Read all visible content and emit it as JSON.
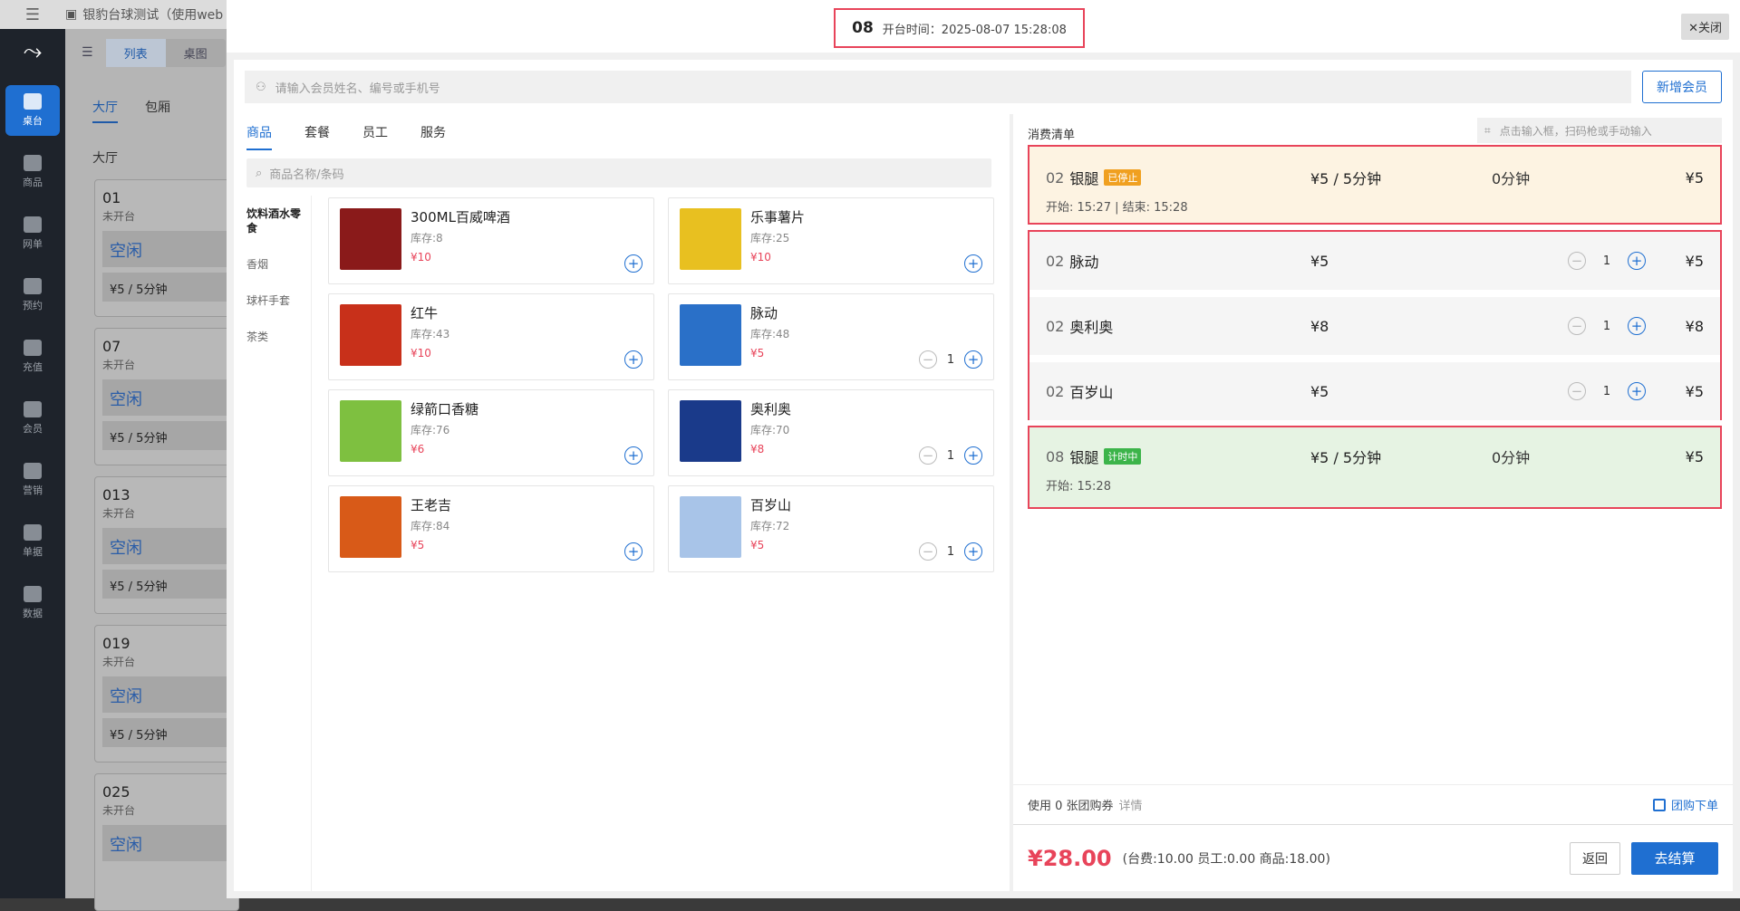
{
  "appbar": {
    "title": "银豹台球测试（使用web"
  },
  "sidebar": {
    "items": [
      {
        "label": "桌台",
        "icon": "table-icon",
        "active": true
      },
      {
        "label": "商品",
        "icon": "goods-icon"
      },
      {
        "label": "网单",
        "icon": "order-icon"
      },
      {
        "label": "预约",
        "icon": "calendar-icon"
      },
      {
        "label": "充值",
        "icon": "recharge-icon"
      },
      {
        "label": "会员",
        "icon": "user-icon"
      },
      {
        "label": "营销",
        "icon": "star-icon"
      },
      {
        "label": "单据",
        "icon": "receipt-icon"
      },
      {
        "label": "数据",
        "icon": "chart-icon"
      }
    ]
  },
  "background": {
    "view_toggle": [
      "列表",
      "桌图"
    ],
    "area_tabs": [
      "大厅",
      "包厢"
    ],
    "area_title": "大厅",
    "tables": [
      {
        "no": "01",
        "status": "未开台",
        "state": "空闲",
        "price": "¥5 / 5分钟"
      },
      {
        "no": "07",
        "status": "未开台",
        "state": "空闲",
        "price": "¥5 / 5分钟"
      },
      {
        "no": "013",
        "status": "未开台",
        "state": "空闲",
        "price": "¥5 / 5分钟"
      },
      {
        "no": "019",
        "status": "未开台",
        "state": "空闲",
        "price": "¥5 / 5分钟"
      },
      {
        "no": "025",
        "status": "未开台",
        "state": "空闲",
        "price": ""
      }
    ]
  },
  "header": {
    "table_no": "08",
    "open_time": "开台时间：2025-08-07 15:28:08",
    "close_label": "关闭"
  },
  "member": {
    "placeholder": "请输入会员姓名、编号或手机号",
    "new_label": "新增会员"
  },
  "goods": {
    "tabs": [
      "商品",
      "套餐",
      "员工",
      "服务"
    ],
    "search_placeholder": "商品名称/条码",
    "subcats": [
      "饮料酒水零食",
      "香烟",
      "球杆手套",
      "茶类"
    ],
    "items": [
      {
        "name": "300ML百威啤酒",
        "stock": "库存:8",
        "price": "¥10",
        "qty": "",
        "img": "#8a1a1a"
      },
      {
        "name": "乐事薯片",
        "stock": "库存:25",
        "price": "¥10",
        "qty": "",
        "img": "#e8c020"
      },
      {
        "name": "红牛",
        "stock": "库存:43",
        "price": "¥10",
        "qty": "",
        "img": "#c8301a"
      },
      {
        "name": "脉动",
        "stock": "库存:48",
        "price": "¥5",
        "qty": "1",
        "img": "#2a70c8"
      },
      {
        "name": "绿箭口香糖",
        "stock": "库存:76",
        "price": "¥6",
        "qty": "",
        "img": "#7ec040"
      },
      {
        "name": "奥利奥",
        "stock": "库存:70",
        "price": "¥8",
        "qty": "1",
        "img": "#1a3a8a"
      },
      {
        "name": "王老吉",
        "stock": "库存:84",
        "price": "¥5",
        "qty": "",
        "img": "#d85a18"
      },
      {
        "name": "百岁山",
        "stock": "库存:72",
        "price": "¥5",
        "qty": "1",
        "img": "#a8c4e8"
      }
    ]
  },
  "bill": {
    "title": "消费清单",
    "scan_placeholder": "点击输入框，扫码枪或手动输入",
    "stopped": {
      "table": "02",
      "name": "银腿",
      "badge": "已停止",
      "badge_color": "#f0a020",
      "rate": "¥5 / 5分钟",
      "duration": "0分钟",
      "amount": "¥5",
      "times": "开始: 15:27 | 结束: 15:28"
    },
    "goods": [
      {
        "table": "02",
        "name": "脉动",
        "price": "¥5",
        "qty": "1",
        "amount": "¥5"
      },
      {
        "table": "02",
        "name": "奥利奥",
        "price": "¥8",
        "qty": "1",
        "amount": "¥8"
      },
      {
        "table": "02",
        "name": "百岁山",
        "price": "¥5",
        "qty": "1",
        "amount": "¥5"
      }
    ],
    "running": {
      "table": "08",
      "name": "银腿",
      "badge": "计时中",
      "badge_color": "#3cb44a",
      "rate": "¥5 / 5分钟",
      "duration": "0分钟",
      "amount": "¥5",
      "times": "开始: 15:28"
    },
    "coupon_text": "使用 0 张团购券",
    "coupon_detail": "详情",
    "groupbuy_label": "团购下单",
    "total": "¥28.00",
    "breakdown": "(台费:10.00  员工:0.00  商品:18.00)",
    "back_label": "返回",
    "pay_label": "去结算"
  }
}
